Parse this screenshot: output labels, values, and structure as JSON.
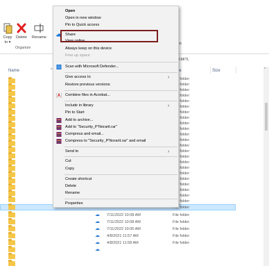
{
  "ribbon": {
    "copy_to": "Copy\nto ▾",
    "delete": "Delete",
    "rename": "Rename",
    "organize": "Organize",
    "right_line1": "ne",
    "right_line2": "ection"
  },
  "address": {
    "text": "re - KMITL"
  },
  "columns": {
    "name": "Name",
    "type": "ype",
    "size": "Size"
  },
  "context_menu": {
    "open": "Open",
    "open_new_window": "Open in new window",
    "pin_quick_access": "Pin to Quick access",
    "share": "Share",
    "view_online": "View online",
    "always_keep": "Always keep on this device",
    "free_up": "Free up space",
    "defender": "Scan with Microsoft Defender...",
    "give_access": "Give access to",
    "restore": "Restore previous versions",
    "combine_acrobat": "Combine files in Acrobat...",
    "include_library": "Include in library",
    "pin_start": "Pin to Start",
    "add_archive": "Add to archive...",
    "add_rar": "Add to \"Security_P'Norarit.rar\"",
    "compress_email": "Compress and email...",
    "compress_rar_email": "Compress to \"Security_P'Norarit.rar\" and email",
    "send_to": "Send to",
    "cut": "Cut",
    "copy": "Copy",
    "create_shortcut": "Create shortcut",
    "delete": "Delete",
    "rename": "Rename",
    "properties": "Properties"
  },
  "file_types": [
    "File folder",
    "File folder",
    "File folder",
    "File folder",
    "File folder",
    "File folder",
    "File folder",
    "File folder",
    "File folder",
    "File folder",
    "File folder",
    "File folder",
    "File folder",
    "File folder",
    "File folder",
    "File folder",
    "File folder",
    "File folder",
    "File folder",
    "File folder",
    "File folder",
    "File folder",
    "File folder",
    "File folder"
  ],
  "rows_bottom": [
    {
      "date": "7/11/2022 10:08 AM",
      "type": "File folder"
    },
    {
      "date": "7/11/2022 10:08 AM",
      "type": "File folder"
    },
    {
      "date": "7/11/2022 10:06 AM",
      "type": "File folder"
    },
    {
      "date": "4/8/2021 11:57 AM",
      "type": "File folder"
    },
    {
      "date": "4/8/2021 11:58 AM",
      "type": "File folder"
    }
  ],
  "selected_row": {
    "type": "File folder"
  },
  "colors": {
    "accent": "#2b7ad6",
    "highlight_box": "#7b1c1c",
    "folder": "#f5c648",
    "selected_row": "#cce8ff"
  }
}
